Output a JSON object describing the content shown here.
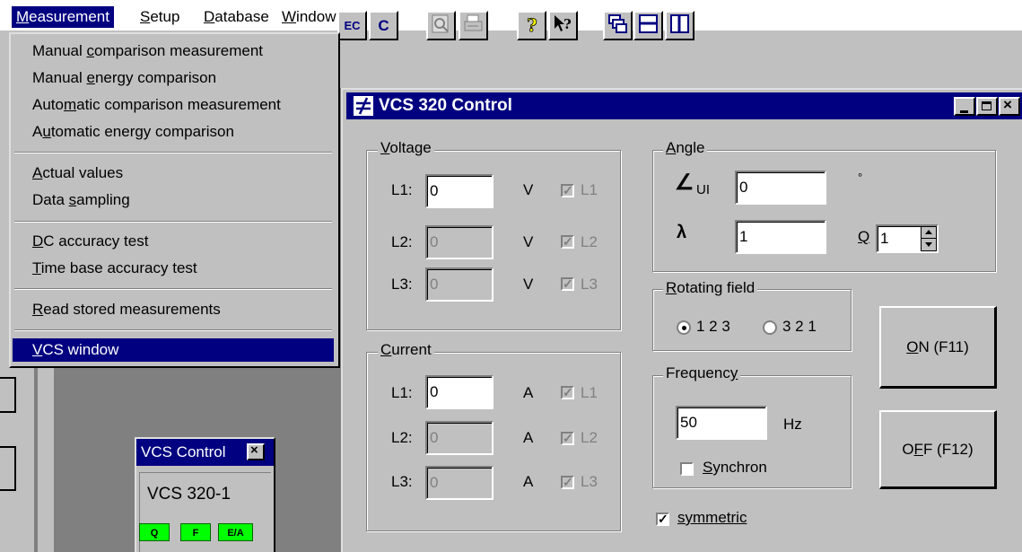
{
  "menubar": {
    "items": [
      {
        "label": "Measurement",
        "mnemonic": "M"
      },
      {
        "label": "Setup",
        "mnemonic": "S"
      },
      {
        "label": "Database",
        "mnemonic": "D"
      },
      {
        "label": "Window",
        "mnemonic": "W"
      },
      {
        "label": "?",
        "mnemonic": "?"
      }
    ]
  },
  "toolbar": {
    "buttons": [
      "EC",
      "C",
      "preview",
      "print",
      "help",
      "context-help",
      "cascade",
      "tile-horizontal",
      "tile-vertical"
    ]
  },
  "measurement_menu": {
    "items": [
      {
        "pre": "Manual ",
        "key": "c",
        "post": "omparison measurement"
      },
      {
        "pre": "Manual ",
        "key": "e",
        "post": "nergy comparison"
      },
      {
        "pre": "Auto",
        "key": "m",
        "post": "atic comparison measurement"
      },
      {
        "pre": "A",
        "key": "u",
        "post": "tomatic energy comparison"
      },
      {
        "pre": "",
        "key": "A",
        "post": "ctual values"
      },
      {
        "pre": "Data ",
        "key": "s",
        "post": "ampling"
      },
      {
        "pre": "",
        "key": "D",
        "post": "C accuracy test"
      },
      {
        "pre": "",
        "key": "T",
        "post": "ime base accuracy test"
      },
      {
        "pre": "",
        "key": "R",
        "post": "ead stored measurements"
      },
      {
        "pre": "",
        "key": "V",
        "post": "CS window"
      }
    ]
  },
  "vcs320": {
    "title": "VCS 320 Control",
    "voltage": {
      "group_label": "Voltage",
      "rows": [
        {
          "label": "L1:",
          "value": "0",
          "unit": "V",
          "check": "L1"
        },
        {
          "label": "L2:",
          "value": "0",
          "unit": "V",
          "check": "L2"
        },
        {
          "label": "L3:",
          "value": "0",
          "unit": "V",
          "check": "L3"
        }
      ]
    },
    "current": {
      "group_label": "Current",
      "rows": [
        {
          "label": "L1:",
          "value": "0",
          "unit": "A",
          "check": "L1"
        },
        {
          "label": "L2:",
          "value": "0",
          "unit": "A",
          "check": "L2"
        },
        {
          "label": "L3:",
          "value": "0",
          "unit": "A",
          "check": "L3"
        }
      ]
    },
    "angle": {
      "group_label": "Angle",
      "phi_symbol": "∠",
      "phi_sub": "UI",
      "phi_value": "0",
      "phi_unit": "°",
      "lambda_symbol": "λ",
      "lambda_value": "1",
      "q_label": "Q",
      "q_value": "1"
    },
    "rotating_field": {
      "group_label": "Rotating field",
      "option1": "1 2 3",
      "option2": "3 2 1",
      "selected": "1 2 3"
    },
    "frequency": {
      "group_label": "Frequency",
      "value": "50",
      "unit": "Hz",
      "synchron_label": "Synchron",
      "synchron_checked": false
    },
    "symmetric_label": "symmetric",
    "symmetric_checked": true,
    "on_button": {
      "key": "O",
      "rest": "N  (F11)"
    },
    "off_button": {
      "pre": "O",
      "key": "F",
      "rest": "F  (F12)"
    }
  },
  "vcs_small": {
    "title": "VCS Control",
    "device": "VCS 320-1",
    "indicators": [
      "Q",
      "F",
      "E/A"
    ],
    "indicator_color": "#00ff00"
  },
  "colors": {
    "title_bar": "#000080",
    "face": "#c0c0c0",
    "desktop": "#808080"
  }
}
